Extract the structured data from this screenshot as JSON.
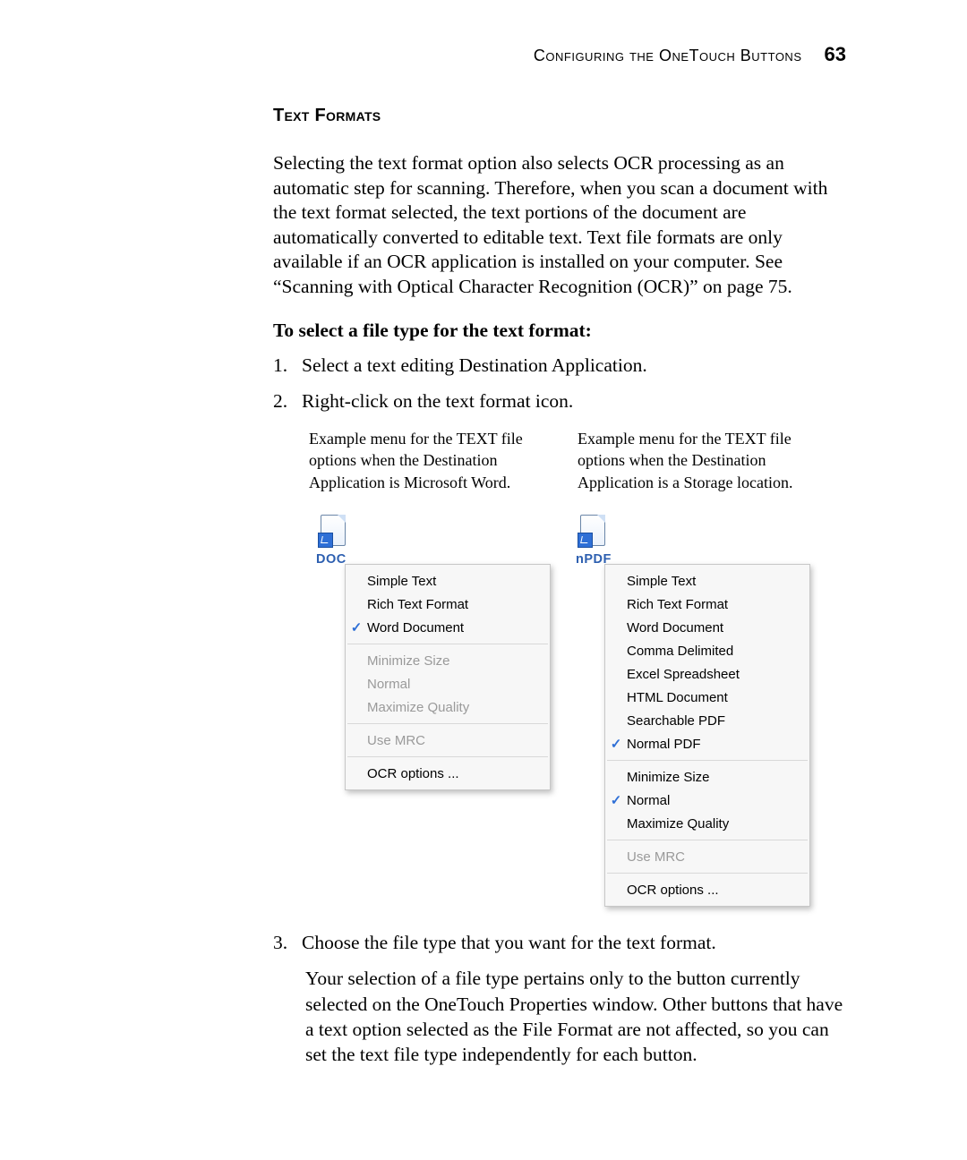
{
  "header": {
    "running_head": "Configuring the OneTouch Buttons",
    "page_number": "63"
  },
  "section_heading": "Text Formats",
  "intro_paragraph": "Selecting the text format option also selects OCR processing as an automatic step for scanning. Therefore, when you scan a document with the text format selected, the text portions of the document are automatically converted to editable text. Text file formats are only available if an OCR application is installed on your computer. See “Scanning with Optical Character Recognition (OCR)” on page 75.",
  "instruction_title": "To select a file type for the text format:",
  "steps": {
    "s1_num": "1.",
    "s1_text": "Select a text editing Destination Application.",
    "s2_num": "2.",
    "s2_text": "Right-click on the text format icon.",
    "s3_num": "3.",
    "s3_text": "Choose the file type that you want for the text format.",
    "s3_followup": "Your selection of a file type pertains only to the button currently selected on the OneTouch Properties window. Other buttons that have a text option selected as the File Format are not affected, so you can set the text file type independently for each button."
  },
  "captions": {
    "left": "Example menu for the TEXT file options when the Destination Application is Microsoft Word.",
    "right": "Example menu for the TEXT file options when the Destination Application is a Storage location."
  },
  "menus": {
    "left": {
      "filetype_label": "DOC",
      "items": [
        {
          "label": "Simple Text",
          "checked": false,
          "disabled": false
        },
        {
          "label": "Rich Text Format",
          "checked": false,
          "disabled": false
        },
        {
          "label": "Word Document",
          "checked": true,
          "disabled": false
        }
      ],
      "quality": [
        {
          "label": "Minimize Size",
          "checked": false,
          "disabled": true
        },
        {
          "label": "Normal",
          "checked": false,
          "disabled": true
        },
        {
          "label": "Maximize Quality",
          "checked": false,
          "disabled": true
        }
      ],
      "mrc": [
        {
          "label": "Use MRC",
          "checked": false,
          "disabled": true
        }
      ],
      "ocr": [
        {
          "label": "OCR options ...",
          "checked": false,
          "disabled": false
        }
      ]
    },
    "right": {
      "filetype_label": "nPDF",
      "items": [
        {
          "label": "Simple Text",
          "checked": false,
          "disabled": false
        },
        {
          "label": "Rich Text Format",
          "checked": false,
          "disabled": false
        },
        {
          "label": "Word Document",
          "checked": false,
          "disabled": false
        },
        {
          "label": "Comma Delimited",
          "checked": false,
          "disabled": false
        },
        {
          "label": "Excel Spreadsheet",
          "checked": false,
          "disabled": false
        },
        {
          "label": "HTML Document",
          "checked": false,
          "disabled": false
        },
        {
          "label": "Searchable PDF",
          "checked": false,
          "disabled": false
        },
        {
          "label": "Normal PDF",
          "checked": true,
          "disabled": false
        }
      ],
      "quality": [
        {
          "label": "Minimize Size",
          "checked": false,
          "disabled": false
        },
        {
          "label": "Normal",
          "checked": true,
          "disabled": false
        },
        {
          "label": "Maximize Quality",
          "checked": false,
          "disabled": false
        }
      ],
      "mrc": [
        {
          "label": "Use MRC",
          "checked": false,
          "disabled": true
        }
      ],
      "ocr": [
        {
          "label": "OCR options ...",
          "checked": false,
          "disabled": false
        }
      ]
    }
  },
  "check_glyph": "✓"
}
